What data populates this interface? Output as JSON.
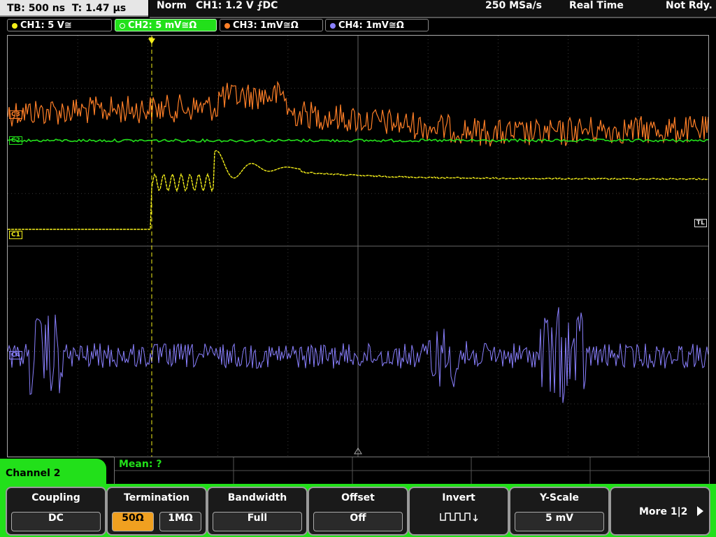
{
  "header": {
    "timebase": "TB: 500 ns",
    "trigger_time": "T: 1.47 µs",
    "mode": "Norm",
    "trigger_info": "CH1: 1.2 V ⨍DC",
    "sample_rate": "250 MSa/s",
    "acq_mode": "Real Time",
    "status": "Not Rdy."
  },
  "channels": [
    {
      "label": "CH1: 5 V≅",
      "color": "#f5f01a"
    },
    {
      "label": "CH2: 5 mV≅Ω",
      "color": "#22e01a"
    },
    {
      "label": "CH3: 1mV≅Ω",
      "color": "#ff7f27"
    },
    {
      "label": "CH4: 1mV≅Ω",
      "color": "#8a80ff"
    }
  ],
  "markers": {
    "ch3": "C3",
    "ch2": "C2",
    "ch1": "C1",
    "ch4": "C4",
    "trigger_level": "TL",
    "trigger_pos": "T"
  },
  "measurement": {
    "label": "Mean: ?"
  },
  "menu": {
    "title": "Channel 2",
    "coupling": {
      "label": "Coupling",
      "value": "DC"
    },
    "termination": {
      "label": "Termination",
      "opt1": "50Ω",
      "opt2": "1MΩ"
    },
    "bandwidth": {
      "label": "Bandwidth",
      "value": "Full"
    },
    "offset": {
      "label": "Offset",
      "value": "Off"
    },
    "invert": {
      "label": "Invert"
    },
    "yscale": {
      "label": "Y-Scale",
      "value": "5 mV"
    },
    "more": "More 1|2"
  }
}
